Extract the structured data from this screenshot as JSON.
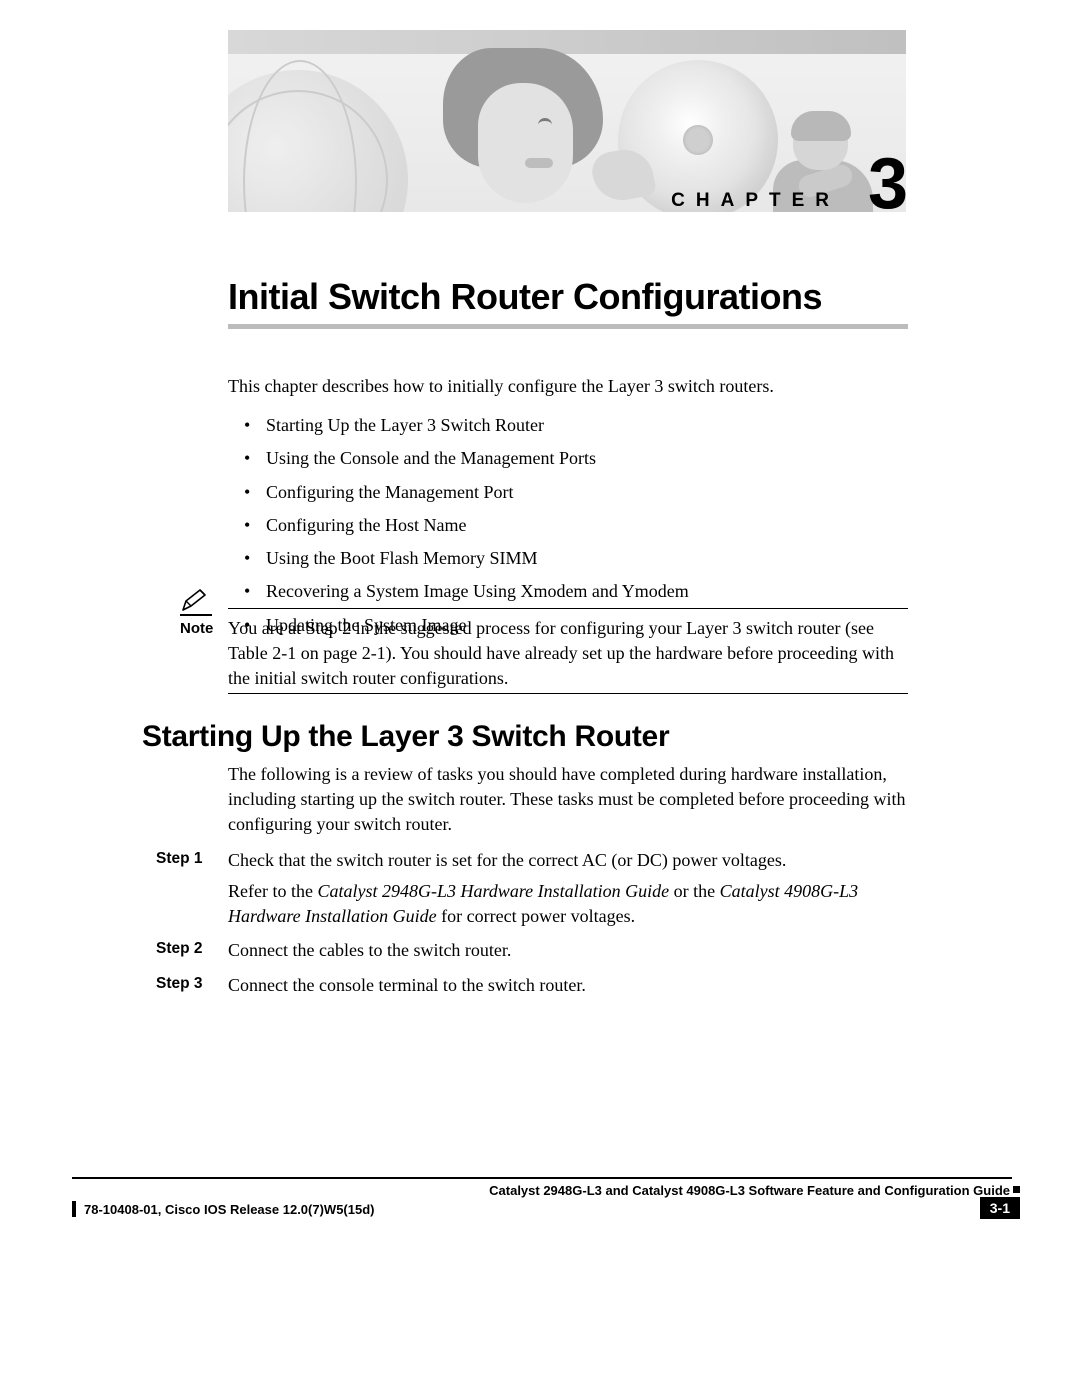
{
  "chapter": {
    "label": "CHAPTER",
    "number": "3",
    "title": "Initial Switch Router Configurations"
  },
  "intro": "This chapter describes how to initially configure the Layer 3 switch routers.",
  "bullets": [
    "Starting Up the Layer 3 Switch Router",
    "Using the Console and the Management Ports",
    "Configuring the Management Port",
    "Configuring the Host Name",
    "Using the Boot Flash Memory SIMM",
    "Recovering a System Image Using Xmodem and Ymodem",
    "Updating the System Image"
  ],
  "note": {
    "label": "Note",
    "text": "You are at Step 2 in the suggested process for configuring your Layer 3 switch router (see Table 2-1 on page 2-1). You should have already set up the hardware before proceeding with the initial switch router configurations."
  },
  "section": {
    "heading": "Starting Up the Layer 3 Switch Router",
    "intro": "The following is a review of tasks you should have completed during hardware installation, including starting up the switch router. These tasks must be completed before proceeding with configuring your switch router."
  },
  "steps": [
    {
      "label": "Step 1",
      "text": "Check that the switch router is set for the correct AC (or DC) power voltages.",
      "sub_pre": "Refer to the ",
      "sub_em1": "Catalyst 2948G-L3 Hardware Installation Guide",
      "sub_mid": " or the ",
      "sub_em2": "Catalyst 4908G-L3 Hardware Installation Guide",
      "sub_post": " for correct power voltages."
    },
    {
      "label": "Step 2",
      "text": "Connect the cables to the switch router."
    },
    {
      "label": "Step 3",
      "text": "Connect the console terminal to the switch router."
    }
  ],
  "footer": {
    "guide": "Catalyst 2948G-L3 and Catalyst 4908G-L3 Software Feature and Configuration Guide",
    "release": "78-10408-01, Cisco IOS Release 12.0(7)W5(15d)",
    "page": "3-1"
  }
}
